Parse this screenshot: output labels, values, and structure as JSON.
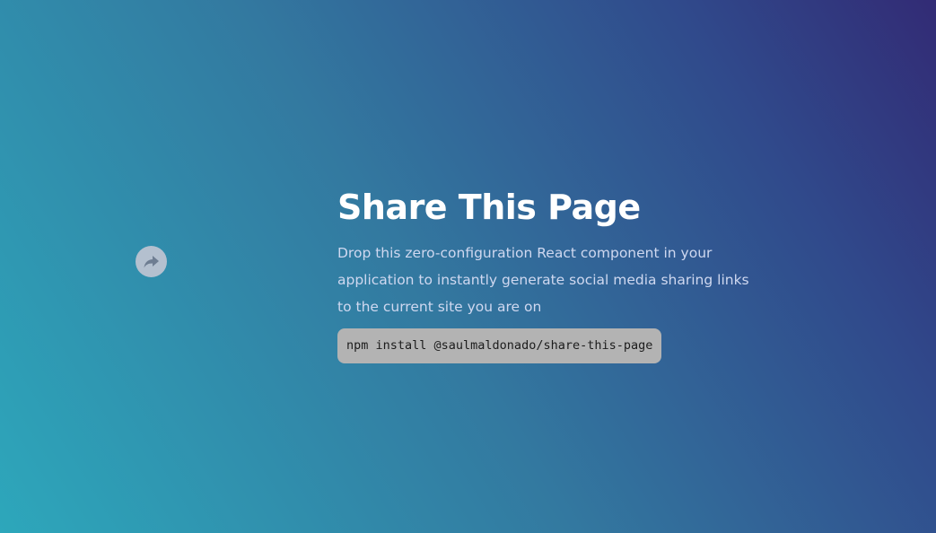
{
  "share_button": {
    "icon": "share-arrow-icon"
  },
  "hero": {
    "title": "Share This Page",
    "description": "Drop this zero-configuration React component in your application to instantly generate social media sharing links to the current site you are on",
    "install_command": "npm install @saulmaldonado/share-this-page"
  },
  "colors": {
    "gradient_start": "#2da7bb",
    "gradient_end": "#322b75",
    "share_button_bg": "#b4c0cf",
    "share_icon": "#6e7d92",
    "code_bg": "#b3b3b3"
  }
}
